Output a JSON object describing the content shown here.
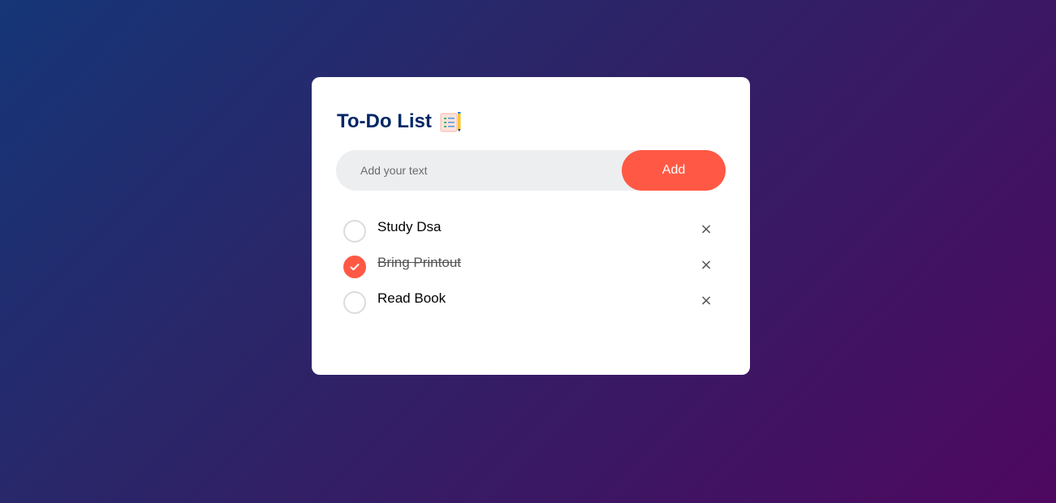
{
  "app": {
    "title": "To-Do List",
    "title_icon": "notepad-checklist-icon"
  },
  "input": {
    "placeholder": "Add your text",
    "value": ""
  },
  "add_button": {
    "label": "Add"
  },
  "tasks": [
    {
      "text": "Study Dsa",
      "checked": false,
      "remove_label": "×"
    },
    {
      "text": "Bring Printout",
      "checked": true,
      "remove_label": "×"
    },
    {
      "text": "Read Book",
      "checked": false,
      "remove_label": "×"
    }
  ],
  "colors": {
    "accent": "#ff5945",
    "title": "#002765",
    "gradient_start": "#153677",
    "gradient_end": "#4e085f",
    "input_bg": "#edeef0"
  }
}
